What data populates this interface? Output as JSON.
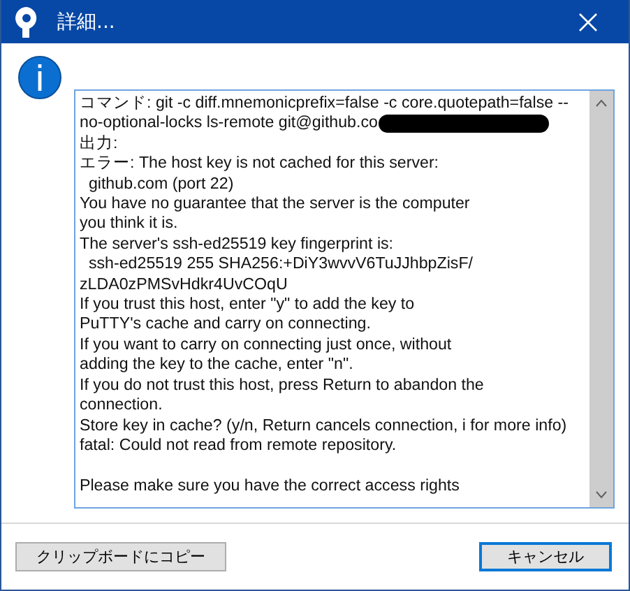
{
  "window": {
    "title": "詳細..."
  },
  "output": {
    "lines": [
      {
        "text": "コマンド: git -c diff.mnemonicprefix=false -c core.quotepath=false --",
        "redacted": false
      },
      {
        "text": "no-optional-locks ls-remote git@github.co",
        "redacted": true
      },
      {
        "text": "出力:",
        "redacted": false
      },
      {
        "text": "エラー: The host key is not cached for this server:",
        "redacted": false
      },
      {
        "text": "  github.com (port 22)",
        "redacted": false
      },
      {
        "text": "You have no guarantee that the server is the computer",
        "redacted": false
      },
      {
        "text": "you think it is.",
        "redacted": false
      },
      {
        "text": "The server's ssh-ed25519 key fingerprint is:",
        "redacted": false
      },
      {
        "text": "  ssh-ed25519 255 SHA256:+DiY3wvvV6TuJJhbpZisF/",
        "redacted": false
      },
      {
        "text": "zLDA0zPMSvHdkr4UvCOqU",
        "redacted": false
      },
      {
        "text": "If you trust this host, enter \"y\" to add the key to",
        "redacted": false
      },
      {
        "text": "PuTTY's cache and carry on connecting.",
        "redacted": false
      },
      {
        "text": "If you want to carry on connecting just once, without",
        "redacted": false
      },
      {
        "text": "adding the key to the cache, enter \"n\".",
        "redacted": false
      },
      {
        "text": "If you do not trust this host, press Return to abandon the",
        "redacted": false
      },
      {
        "text": "connection.",
        "redacted": false
      },
      {
        "text": "Store key in cache? (y/n, Return cancels connection, i for more info)",
        "redacted": false
      },
      {
        "text": "fatal: Could not read from remote repository.",
        "redacted": false
      },
      {
        "text": "Please make sure you have the correct access rights",
        "redacted": false,
        "blank_line_before": true
      }
    ]
  },
  "buttons": [
    {
      "label": "クリップボードにコピー",
      "default": false
    },
    {
      "label": "キャンセル",
      "default": true
    }
  ]
}
